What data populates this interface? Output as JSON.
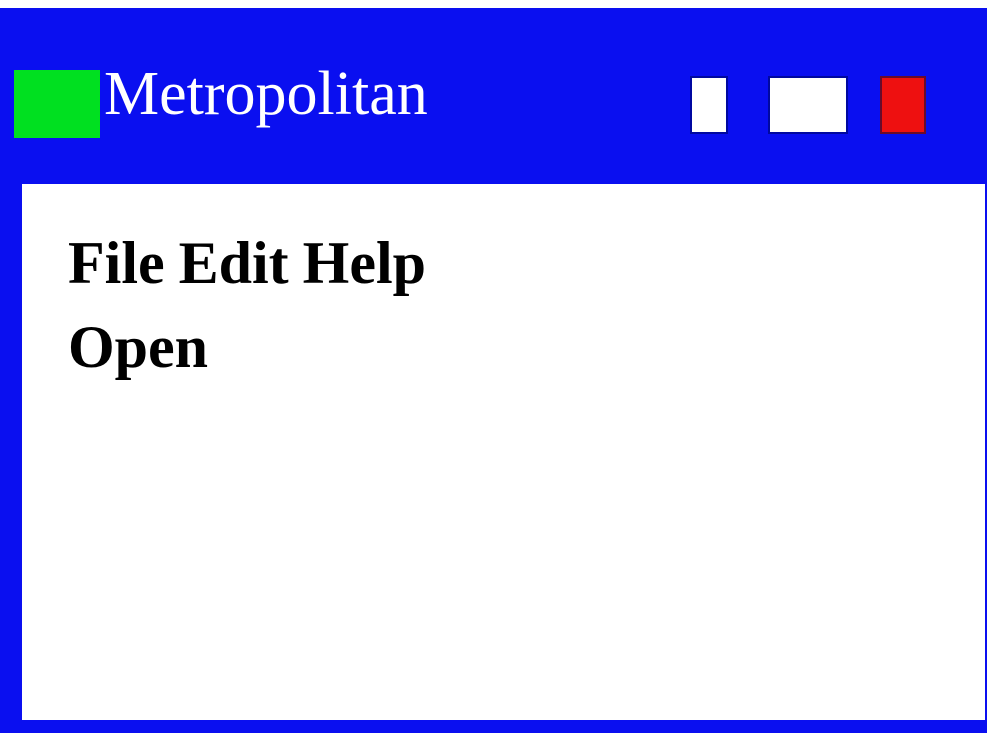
{
  "window": {
    "title": "Metropolitan",
    "controls": {
      "minimize": "minimize-button",
      "maximize": "maximize-button",
      "close": "close-button"
    },
    "colors": {
      "frame": "#0a0ff0",
      "app_icon": "#00e020",
      "close": "#ee1010",
      "title_text": "#ffffff"
    }
  },
  "menubar": {
    "items": [
      {
        "label": "File"
      },
      {
        "label": "Edit"
      },
      {
        "label": "Help"
      }
    ]
  },
  "submenu": {
    "items": [
      {
        "label": "Open"
      }
    ]
  }
}
